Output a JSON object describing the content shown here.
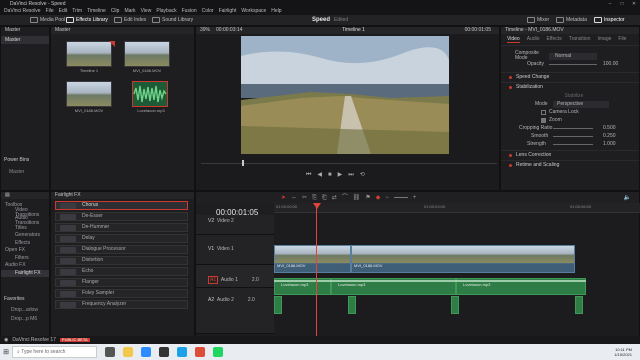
{
  "app": {
    "title": "DaVinci Resolve - Speed",
    "version": "DaVinci Resolve 17",
    "beta": "PUBLIC BETA"
  },
  "menu": [
    "DaVinci Resolve",
    "File",
    "Edit",
    "Trim",
    "Timeline",
    "Clip",
    "Mark",
    "View",
    "Playback",
    "Fusion",
    "Color",
    "Fairlight",
    "Workspace",
    "Help"
  ],
  "toolbar": {
    "media_pool": "Media Pool",
    "effects_library": "Effects Library",
    "edit_index": "Edit Index",
    "sound_library": "Sound Library",
    "project": "Speed",
    "edited": "Edited",
    "mixer": "Mixer",
    "metadata": "Metadata",
    "inspector": "Inspector"
  },
  "left_panel": {
    "master_tab": "Master",
    "bin_header": "Master",
    "power_bins": "Power Bins",
    "power_master": "Master",
    "smart_bins": "Smart Bins",
    "keywords": "Keywords"
  },
  "media_pool": {
    "clips": [
      {
        "name": "Timeline 1"
      },
      {
        "name": "MVI_0186.MOV"
      },
      {
        "name": "MVI_0188.MOV"
      },
      {
        "name": "Lovelaoon.mp3"
      }
    ]
  },
  "viewer": {
    "zoom": "39%",
    "tc_left": "00:00:03:14",
    "timeline_name": "Timeline 1",
    "tc_right": "00:00:01:05"
  },
  "inspector": {
    "timeline_label": "Timeline - MVI_0186.MOV",
    "tabs": [
      "Video",
      "Audio",
      "Effects",
      "Transition",
      "Image",
      "File"
    ],
    "composite_mode": "Composite Mode",
    "composite_value": "Normal",
    "opacity": "Opacity",
    "opacity_value": "100.00",
    "speed_change": "Speed Change",
    "stabilization": "Stabilization",
    "mode": "Mode",
    "mode_value": "Perspective",
    "camera_lock": "Camera Lock",
    "zoom": "Zoom",
    "cropping_ratio": "Cropping Ratio",
    "cropping_value": "0.500",
    "smooth": "Smooth",
    "smooth_value": "0.250",
    "strength": "Strength",
    "strength_value": "1.000",
    "stabilize_btn": "Stabilize",
    "lens_correction": "Lens Correction",
    "retime_scaling": "Retime and Scaling"
  },
  "effects": {
    "header": "Fairlight FX",
    "tree": [
      "Toolbox",
      "Video Transitions",
      "Audio Transitions",
      "Titles",
      "Generators",
      "Effects",
      "Open FX",
      "Filters",
      "Audio FX",
      "Fairlight FX"
    ],
    "favorites": "Favorites",
    "fav_items": [
      "Drop...arlow",
      "Drop...p M6"
    ],
    "items": [
      "Chorus",
      "De-Esser",
      "De-Hummer",
      "Delay",
      "Dialogue Processor",
      "Distortion",
      "Echo",
      "Flanger",
      "Foley Sampler",
      "Frequency Analyzer"
    ]
  },
  "timeline": {
    "timecode": "00:00:01:05",
    "ruler": [
      "01:00:00:00",
      "01:00:03:00",
      "01:00:06:00"
    ],
    "tracks": [
      {
        "id": "V2",
        "name": "Video 2"
      },
      {
        "id": "V1",
        "name": "Video 1"
      },
      {
        "id": "A1",
        "name": "Audio 1",
        "ch": "2.0"
      },
      {
        "id": "A2",
        "name": "Audio 2",
        "ch": "2.0"
      }
    ],
    "clips": {
      "v1a": "MVI_0186.MOV",
      "v1b": "MVI_0188.MOV",
      "a1a": "Lovelaoon.mp3",
      "a1b": "Lovelaoon.mp3",
      "a1c": "Lovelaoon.mp3"
    }
  },
  "taskbar": {
    "search": "Type here to search",
    "time": "10:11 PM",
    "date": "1/15/2021"
  }
}
